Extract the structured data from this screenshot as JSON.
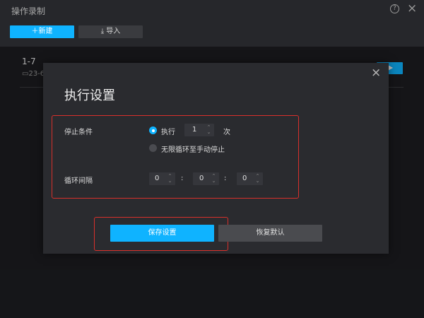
{
  "app": {
    "title": "操作录制",
    "help_icon": "help-circle-icon",
    "close_icon": "close-icon",
    "new_label": "新建",
    "import_label": "导入"
  },
  "record": {
    "title": "1-7",
    "date": "23-6"
  },
  "modal": {
    "title": "执行设置",
    "stop_condition": {
      "label": "停止条件",
      "option_execute": "执行",
      "execute_count": "1",
      "count_unit": "次",
      "option_infinite": "无限循环至手动停止",
      "selected": "execute"
    },
    "interval": {
      "label": "循环间隔",
      "hours": "0",
      "minutes": "0",
      "seconds": "0",
      "separator": ":"
    },
    "save_label": "保存设置",
    "reset_label": "恢复默认"
  },
  "colors": {
    "accent": "#0fb3ff",
    "highlight": "#d9302b",
    "background": "#1c1d21",
    "modal_bg": "#2a2b2f"
  }
}
